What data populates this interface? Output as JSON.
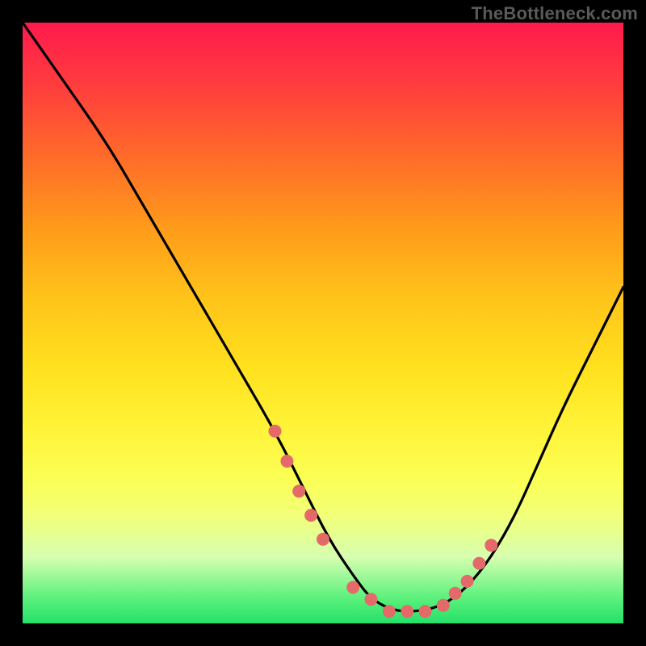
{
  "watermark": "TheBottleneck.com",
  "chart_data": {
    "type": "line",
    "title": "",
    "xlabel": "",
    "ylabel": "",
    "xlim": [
      0,
      100
    ],
    "ylim": [
      0,
      100
    ],
    "grid": false,
    "legend": false,
    "series": [
      {
        "name": "bottleneck-curve",
        "x": [
          0,
          7,
          14,
          21,
          28,
          35,
          42,
          47,
          51,
          55,
          58,
          62,
          66,
          70,
          74,
          78,
          82,
          86,
          90,
          95,
          100
        ],
        "y": [
          100,
          90,
          80,
          68,
          56,
          44,
          32,
          22,
          14,
          8,
          4,
          2,
          2,
          3,
          6,
          11,
          18,
          27,
          36,
          46,
          56
        ],
        "note": "approximate valley-shaped curve read from plot; y expressed as percent of vertical span from bottom"
      }
    ],
    "markers": {
      "name": "highlight-dots",
      "color": "#e46a6a",
      "x": [
        42,
        44,
        46,
        48,
        50,
        55,
        58,
        61,
        64,
        67,
        70,
        72,
        74,
        76,
        78
      ],
      "y": [
        32,
        27,
        22,
        18,
        14,
        6,
        4,
        2,
        2,
        2,
        3,
        5,
        7,
        10,
        13
      ]
    },
    "background_gradient": {
      "top_color": "#ff1a4d",
      "bottom_color": "#26e06a"
    }
  }
}
